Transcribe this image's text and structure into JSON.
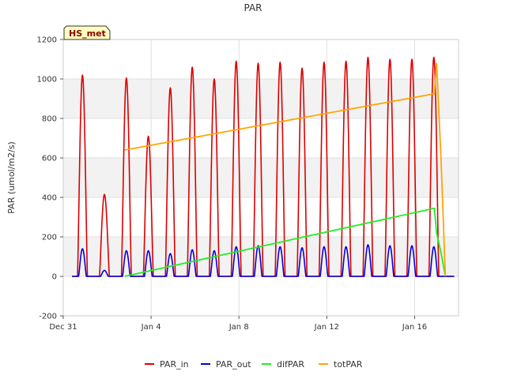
{
  "chart_data": {
    "type": "line",
    "title": "PAR",
    "xlabel": "",
    "ylabel": "PAR (umol/m2/s)",
    "badge": "HS_met",
    "xlim": [
      0.0,
      18.0
    ],
    "ylim": [
      -200,
      1200
    ],
    "yticks": [
      -200,
      0,
      200,
      400,
      600,
      800,
      1000,
      1200
    ],
    "xticks": [
      {
        "x": 0,
        "label": "Dec 31"
      },
      {
        "x": 4,
        "label": "Jan 4"
      },
      {
        "x": 8,
        "label": "Jan 8"
      },
      {
        "x": 12,
        "label": "Jan 12"
      },
      {
        "x": 16,
        "label": "Jan 16"
      }
    ],
    "grid": true,
    "legend_position": "bottom",
    "days": [
      {
        "peak_in": 1020,
        "peak_out": 140
      },
      {
        "peak_in": 415,
        "peak_out": 30
      },
      {
        "peak_in": 1005,
        "peak_out": 130
      },
      {
        "peak_in": 710,
        "peak_out": 130
      },
      {
        "peak_in": 955,
        "peak_out": 115
      },
      {
        "peak_in": 1060,
        "peak_out": 135
      },
      {
        "peak_in": 1000,
        "peak_out": 130
      },
      {
        "peak_in": 1090,
        "peak_out": 150
      },
      {
        "peak_in": 1080,
        "peak_out": 155
      },
      {
        "peak_in": 1085,
        "peak_out": 150
      },
      {
        "peak_in": 1055,
        "peak_out": 145
      },
      {
        "peak_in": 1085,
        "peak_out": 150
      },
      {
        "peak_in": 1090,
        "peak_out": 150
      },
      {
        "peak_in": 1110,
        "peak_out": 160
      },
      {
        "peak_in": 1100,
        "peak_out": 155
      },
      {
        "peak_in": 1100,
        "peak_out": 155
      },
      {
        "peak_in": 1110,
        "peak_out": 150
      }
    ],
    "series": [
      {
        "name": "PAR_in",
        "color": "#dd0000"
      },
      {
        "name": "PAR_out",
        "color": "#0000dd"
      },
      {
        "name": "difPAR",
        "color": "#22ee22",
        "points": [
          [
            2.8,
            0
          ],
          [
            16.9,
            345
          ],
          [
            17.0,
            220
          ],
          [
            17.2,
            120
          ],
          [
            17.4,
            0
          ]
        ]
      },
      {
        "name": "totPAR",
        "color": "#ffa500",
        "points": [
          [
            2.8,
            640
          ],
          [
            16.9,
            925
          ],
          [
            17.0,
            1080
          ],
          [
            17.2,
            600
          ],
          [
            17.4,
            0
          ]
        ]
      }
    ]
  }
}
